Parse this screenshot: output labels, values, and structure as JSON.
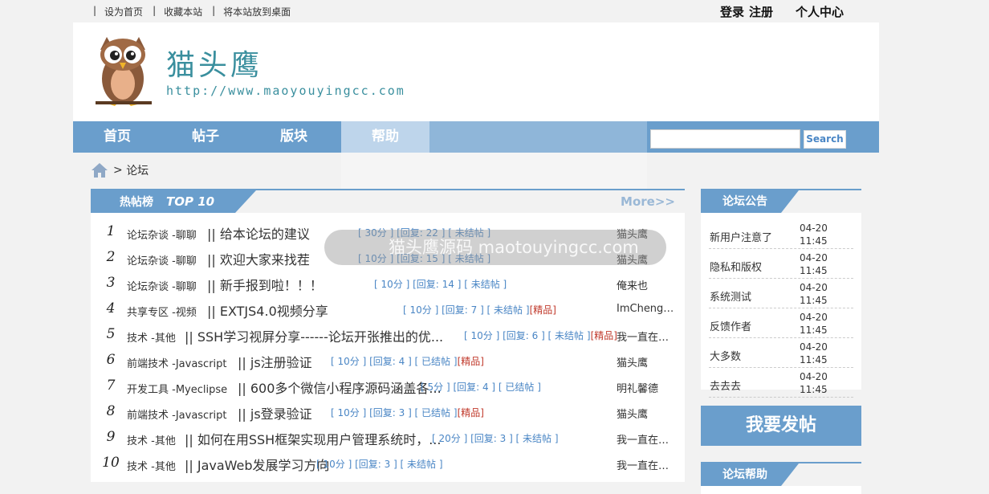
{
  "topbar": {
    "sep": "|",
    "links": [
      "设为首页",
      "收藏本站",
      "将本站放到桌面"
    ],
    "login": "登录",
    "register": "注册",
    "user_center": "个人中心"
  },
  "header": {
    "site_name": "猫头鹰",
    "site_url": "http://www.maoyouyingcc.com"
  },
  "nav": {
    "items": [
      "首页",
      "帖子",
      "版块",
      "帮助"
    ],
    "search_button": "Search",
    "search_value": ""
  },
  "breadcrumb": {
    "sep": ">",
    "current": "论坛"
  },
  "hot": {
    "title": "热帖榜",
    "subtitle": "TOP 10",
    "more": "More>>",
    "rows": [
      {
        "num": "1",
        "cat": "论坛杂谈 -聊聊",
        "title": "|| 给本论坛的建议",
        "meta": "[ 30分 ] [回复: 22 ] [ 未结帖 ]",
        "tag": "",
        "author": "猫头鹰"
      },
      {
        "num": "2",
        "cat": "论坛杂谈 -聊聊",
        "title": "|| 欢迎大家来找茬",
        "meta": "[ 10分 ] [回复: 15 ] [ 未结帖 ]",
        "tag": "",
        "author": "猫头鹰"
      },
      {
        "num": "3",
        "cat": "论坛杂谈 -聊聊",
        "title": "|| 新手报到啦！！！",
        "meta": "[ 10分 ] [回复: 14 ] [ 未结帖 ]",
        "tag": "",
        "author": "俺来也"
      },
      {
        "num": "4",
        "cat": "共享专区 -视频",
        "title": "|| EXTJS4.0视频分享",
        "meta": "[ 10分 ] [回复: 7 ] [ 未结帖 ]",
        "tag": "[精品]",
        "author": "ImCheng…"
      },
      {
        "num": "5",
        "cat": "技术 -其他",
        "title": "|| SSH学习视屏分享------论坛开张推出的优...",
        "meta": "[ 10分 ] [回复: 6 ] [ 未结帖 ]",
        "tag": "[精品]",
        "author": "我一直在…"
      },
      {
        "num": "6",
        "cat": "前端技术 -Javascript",
        "title": "|| js注册验证",
        "meta": "[ 10分 ] [回复: 4 ] [ 已结帖 ]",
        "tag": "[精品]",
        "author": "猫头鹰"
      },
      {
        "num": "7",
        "cat": "开发工具 -Myeclipse",
        "title": "|| 600多个微信小程序源码涵盖各...",
        "meta": "[ 5分 ] [回复: 4 ] [ 已结帖 ]",
        "tag": "",
        "author": "明礼馨德"
      },
      {
        "num": "8",
        "cat": "前端技术 -Javascript",
        "title": "|| js登录验证",
        "meta": "[ 10分 ] [回复: 3 ] [ 已结帖 ]",
        "tag": "[精品]",
        "author": "猫头鹰"
      },
      {
        "num": "9",
        "cat": "技术 -其他",
        "title": "|| 如何在用SSH框架实现用户管理系统时，...",
        "meta": "[ 20分 ] [回复: 3 ] [ 未结帖 ]",
        "tag": "",
        "author": "我一直在…"
      },
      {
        "num": "10",
        "cat": "技术 -其他",
        "title": "|| JavaWeb发展学习方向",
        "meta": "[ 10分 ] [回复: 3 ] [ 未结帖 ]",
        "tag": "",
        "author": "我一直在…"
      }
    ]
  },
  "notice": {
    "title": "论坛公告",
    "items": [
      {
        "title": "新用户注意了",
        "date": "04-20",
        "time": "11:45"
      },
      {
        "title": "隐私和版权",
        "date": "04-20",
        "time": "11:45"
      },
      {
        "title": "系统测试",
        "date": "04-20",
        "time": "11:45"
      },
      {
        "title": "反馈作者",
        "date": "04-20",
        "time": "11:45"
      },
      {
        "title": "大多数",
        "date": "04-20",
        "time": "11:45"
      },
      {
        "title": "去去去",
        "date": "04-20",
        "time": "11:45"
      }
    ]
  },
  "post_button": "我要发帖",
  "help": {
    "title": "论坛帮助"
  },
  "watermark": {
    "text": "猫头鹰源码 maotouyingcc.com"
  },
  "colors": {
    "accent": "#6a9ecc",
    "brand_text": "#3a8f9e",
    "meta": "#4a86c5",
    "tag": "#c0392b"
  }
}
